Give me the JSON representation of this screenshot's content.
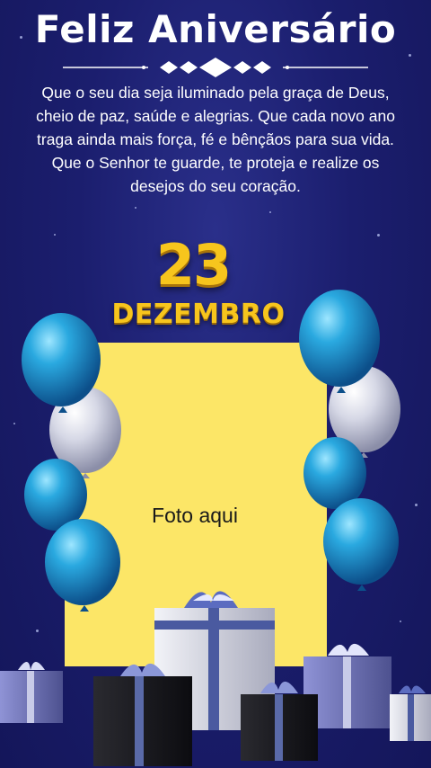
{
  "title": "Feliz Aniversário",
  "message": "Que o seu dia seja iluminado pela graça de Deus, cheio de paz, saúde e alegrias. Que cada novo ano traga ainda mais força, fé e bênçãos para sua vida. Que o Senhor te guarde, te proteja e realize os desejos do seu coração.",
  "date": {
    "day": "23",
    "month": "DEZEMBRO"
  },
  "photo": {
    "label": "Foto aqui"
  },
  "colors": {
    "background": "#1b1e6e",
    "gold": "#f7c51d",
    "photo_box": "#fce667",
    "balloon_blue": "#2aa3d8",
    "balloon_silver": "#d9dbe8"
  },
  "decorations": [
    "balloon-icon",
    "gift-box-icon",
    "diamond-ornament-icon"
  ]
}
